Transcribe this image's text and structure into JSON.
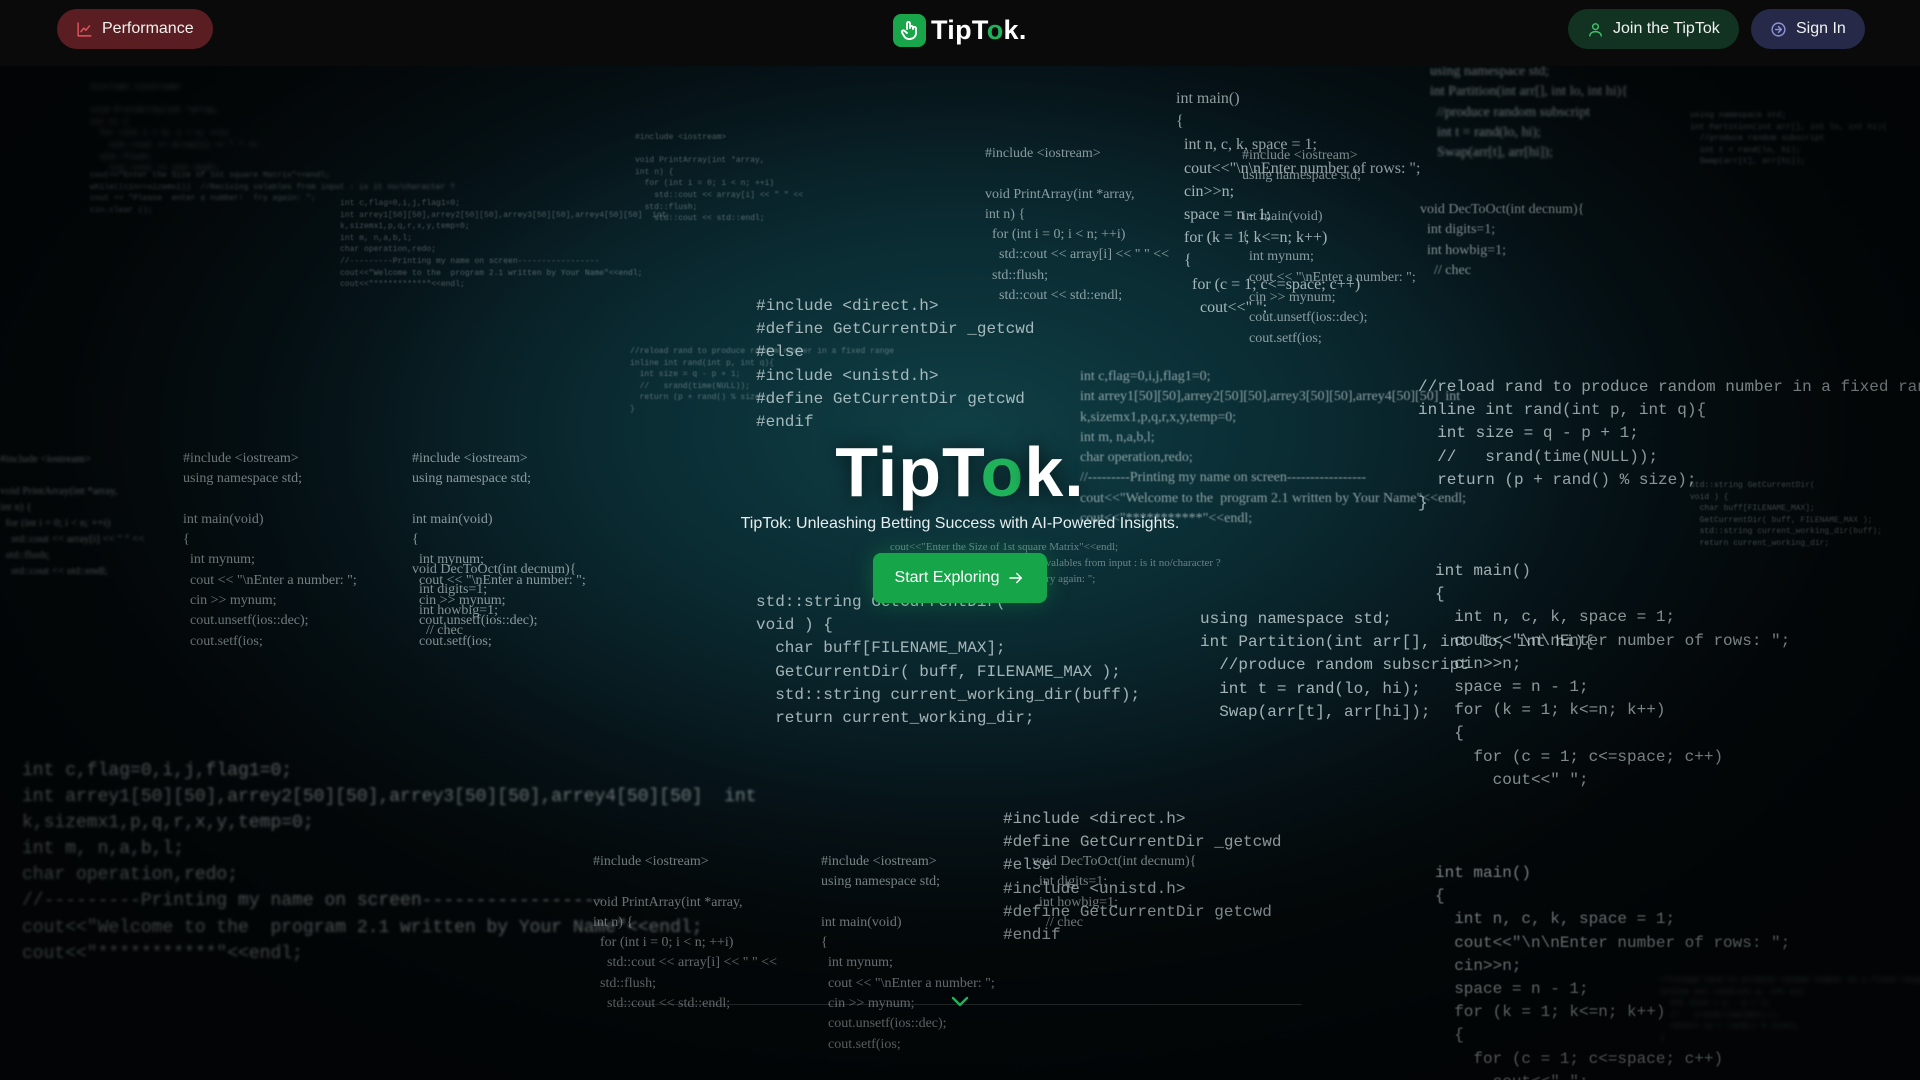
{
  "navbar": {
    "performance_label": "Performance",
    "brand": {
      "name_prefix": "TipT",
      "name_highlight": "o",
      "name_suffix": "k."
    },
    "join_label": "Join the TipTok",
    "sign_in_label": "Sign In"
  },
  "hero": {
    "title_prefix": "TipT",
    "title_highlight": "o",
    "title_suffix": "k.",
    "subtitle": "TipTok: Unleashing Betting Success with AI-Powered Insights.",
    "cta_label": "Start Exploring"
  },
  "colors": {
    "accent_green": "#17a54a",
    "performance_bg": "#5a1e22",
    "join_bg": "#123322",
    "signin_bg": "#262a48",
    "navbar_bg": "#0a0a0a"
  },
  "icons": {
    "performance": "chart-line-icon",
    "join": "user-icon",
    "sign_in": "sign-in-icon",
    "logo": "hand-icon",
    "cta": "arrow-right-icon",
    "scroll": "chevron-down-icon"
  },
  "background_code": [
    "int main()\n{\n  int n, c, k, space = 1;\n  cout<<\"\\n\\nEnter number of rows: \";\n  cin>>n;\n  space = n - 1;\n  for (k = 1; k<=n; k++)\n  {\n    for (c = 1; c<=space; c++)\n      cout<<\" \";",
    "#include <iostream>\n\nvoid PrintArray(int *array,\nint n) {\n  for (int i = 0; i < n; ++i)\n    std::cout << array[i] << \" \" <<\n  std::flush;\n    std::cout << std::endl;",
    "#include <direct.h>\n#define GetCurrentDir _getcwd\n#else\n#include <unistd.h>\n#define GetCurrentDir getcwd\n#endif",
    "std::string GetCurrentDir(\nvoid ) {\n  char buff[FILENAME_MAX];\n  GetCurrentDir( buff, FILENAME_MAX );\n  std::string current_working_dir(buff);\n  return current_working_dir;",
    "#include <iostream>\nusing namespace std;\n\nint main(void)\n{\n  int mynum;\n  cout << \"\\nEnter a number: \";\n  cin >> mynum;\n  cout.unsetf(ios::dec);\n  cout.setf(ios;",
    "//reload rand to produce random number in a fixed range\ninline int rand(int p, int q){\n  int size = q - p + 1;\n  //   srand(time(NULL));\n  return (p + rand() % size);\n}",
    "using namespace std;\nint Partition(int arr[], int lo, int hi){\n  //produce random subscript\n  int t = rand(lo, hi);\n  Swap(arr[t], arr[hi]);",
    "void DecToOct(int decnum){\n  int digits=1;\n  int howbig=1;\n    // chec",
    "int c,flag=0,i,j,flag1=0;\nint arrey1[50][50],arrey2[50][50],arrey3[50][50],arrey4[50][50]  int\nk,sizemx1,p,q,r,x,y,temp=0;\nint m, n,a,b,l;\nchar operation,redo;\n//---------Printing my name on screen-----------------\ncout<<\"Welcome to the  program 2.1 written by Your Name\"<<endl;\ncout<<\"***********\"<<endl;",
    "cout<<\"Enter the Size of 1st square Matrix\"<<endl;\nwhile((cin>>sizemx1))  //Reciving valables from input : is it no/character ?\ncout << \"Please  enter a number!  Try again: \";\ncin.clear ();"
  ]
}
